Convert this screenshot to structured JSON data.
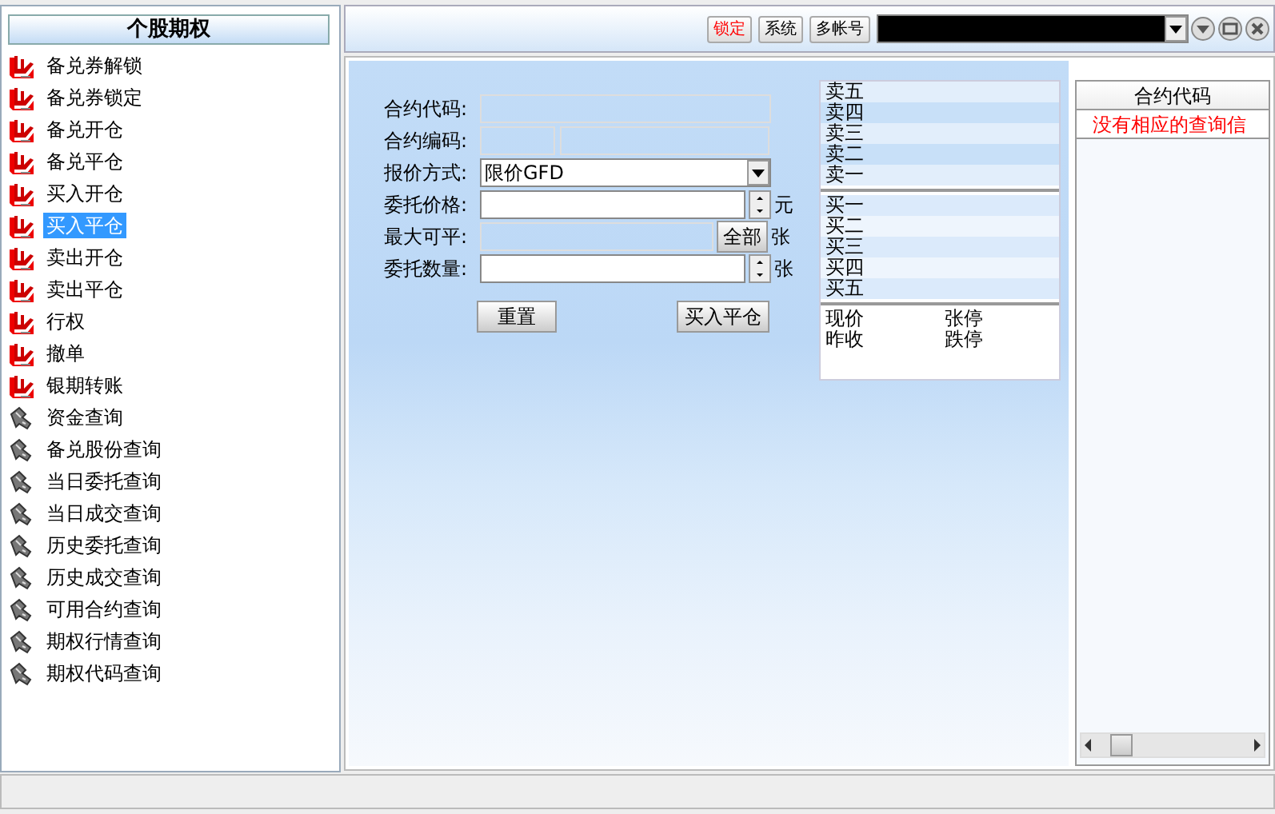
{
  "sidebar": {
    "title": "个股期权",
    "items": [
      {
        "label": "备兑券解锁",
        "kind": "trade",
        "selected": false
      },
      {
        "label": "备兑券锁定",
        "kind": "trade",
        "selected": false
      },
      {
        "label": "备兑开仓",
        "kind": "trade",
        "selected": false
      },
      {
        "label": "备兑平仓",
        "kind": "trade",
        "selected": false
      },
      {
        "label": "买入开仓",
        "kind": "trade",
        "selected": false
      },
      {
        "label": "买入平仓",
        "kind": "trade",
        "selected": true
      },
      {
        "label": "卖出开仓",
        "kind": "trade",
        "selected": false
      },
      {
        "label": "卖出平仓",
        "kind": "trade",
        "selected": false
      },
      {
        "label": "行权",
        "kind": "trade",
        "selected": false
      },
      {
        "label": "撤单",
        "kind": "trade",
        "selected": false
      },
      {
        "label": "银期转账",
        "kind": "trade",
        "selected": false
      },
      {
        "label": "资金查询",
        "kind": "query",
        "selected": false
      },
      {
        "label": "备兑股份查询",
        "kind": "query",
        "selected": false
      },
      {
        "label": "当日委托查询",
        "kind": "query",
        "selected": false
      },
      {
        "label": "当日成交查询",
        "kind": "query",
        "selected": false
      },
      {
        "label": "历史委托查询",
        "kind": "query",
        "selected": false
      },
      {
        "label": "历史成交查询",
        "kind": "query",
        "selected": false
      },
      {
        "label": "可用合约查询",
        "kind": "query",
        "selected": false
      },
      {
        "label": "期权行情查询",
        "kind": "query",
        "selected": false
      },
      {
        "label": "期权代码查询",
        "kind": "query",
        "selected": false
      }
    ]
  },
  "toolbar": {
    "buttons": [
      {
        "label": "锁定",
        "kind": "alert"
      },
      {
        "label": "系统",
        "kind": "normal"
      },
      {
        "label": "多帐号",
        "kind": "normal"
      }
    ]
  },
  "form": {
    "fields": [
      {
        "label": "合约代码:",
        "kind": "readonly"
      },
      {
        "label": "合约编码:",
        "kind": "split"
      },
      {
        "label": "报价方式:",
        "kind": "select",
        "value": "限价GFD"
      },
      {
        "label": "委托价格:",
        "kind": "spin",
        "unit": "元"
      },
      {
        "label": "最大可平:",
        "kind": "button",
        "button": "全部",
        "unit": "张"
      },
      {
        "label": "委托数量:",
        "kind": "spin",
        "unit": "张"
      }
    ],
    "buttons": [
      "重置",
      "买入平仓"
    ]
  },
  "quote": {
    "asks": [
      "卖五",
      "卖四",
      "卖三",
      "卖二",
      "卖一"
    ],
    "bids": [
      "买一",
      "买二",
      "买三",
      "买四",
      "买五"
    ],
    "info": [
      [
        "现价",
        "张停"
      ],
      [
        "昨收",
        "跌停"
      ]
    ]
  },
  "results": {
    "columns": [
      "合约代码"
    ],
    "message": "没有相应的查询信"
  }
}
